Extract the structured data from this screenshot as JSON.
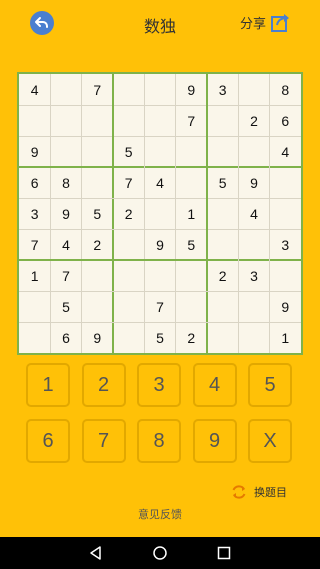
{
  "header": {
    "title": "数独",
    "share_label": "分享"
  },
  "board": [
    [
      "4",
      "",
      "7",
      "",
      "",
      "9",
      "3",
      "",
      "8"
    ],
    [
      "",
      "",
      "",
      "",
      "",
      "7",
      "",
      "2",
      "6"
    ],
    [
      "9",
      "",
      "",
      "5",
      "",
      "",
      "",
      "",
      "4"
    ],
    [
      "6",
      "8",
      "",
      "7",
      "4",
      "",
      "5",
      "9",
      ""
    ],
    [
      "3",
      "9",
      "5",
      "2",
      "",
      "1",
      "",
      "4",
      ""
    ],
    [
      "7",
      "4",
      "2",
      "",
      "9",
      "5",
      "",
      "",
      "3"
    ],
    [
      "1",
      "7",
      "",
      "",
      "",
      "",
      "2",
      "3",
      ""
    ],
    [
      "",
      "5",
      "",
      "",
      "7",
      "",
      "",
      "",
      "9"
    ],
    [
      "",
      "6",
      "9",
      "",
      "5",
      "2",
      "",
      "",
      "1"
    ]
  ],
  "keypad": {
    "keys": [
      "1",
      "2",
      "3",
      "4",
      "5",
      "6",
      "7",
      "8",
      "9",
      "X"
    ]
  },
  "actions": {
    "change_puzzle": "换题目",
    "feedback": "意见反馈"
  },
  "colors": {
    "background": "#FFC107",
    "board_border": "#7FB24A",
    "board_bg": "#FAF6EA",
    "back_button": "#4A7FD0"
  },
  "icons": {
    "back": "back-arrow-icon",
    "share": "share-icon",
    "refresh": "refresh-icon",
    "nav_back": "nav-back-icon",
    "nav_home": "nav-home-icon",
    "nav_recent": "nav-recent-icon"
  }
}
